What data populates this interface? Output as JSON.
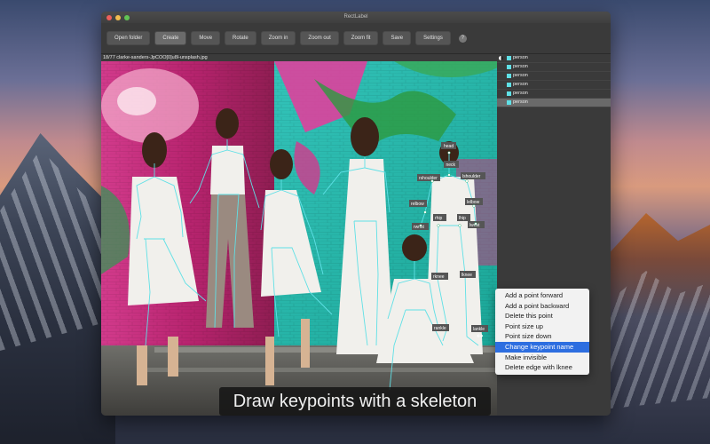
{
  "window": {
    "title": "RectLabel"
  },
  "toolbar": {
    "buttons": [
      "Open folder",
      "Create",
      "Move",
      "Rotate",
      "Zoom in",
      "Zoom out",
      "Zoom fit",
      "Save",
      "Settings"
    ],
    "active": "Create",
    "help": "?"
  },
  "file": {
    "name": "18/77 clarke-sanders-JpCOO[0]u8l-unsplash.jpg"
  },
  "sidebar": {
    "labels": [
      "person",
      "person",
      "person",
      "person",
      "person",
      "person"
    ],
    "selected_index": 5,
    "color": "#5fe0e6"
  },
  "keypoints": {
    "names": [
      "head",
      "neck",
      "rshoulder",
      "lshoulder",
      "relbow",
      "lelbow",
      "rhip",
      "lhip",
      "rwrist",
      "lwrist",
      "lknee",
      "rknee",
      "rankle",
      "lankle"
    ]
  },
  "context_menu": {
    "items": [
      "Add a point forward",
      "Add a point backward",
      "Delete this point",
      "Point size up",
      "Point size down",
      "Change keypoint name",
      "Make invisible",
      "Delete edge with lknee"
    ],
    "highlighted_index": 5
  },
  "caption": "Draw keypoints with a skeleton"
}
